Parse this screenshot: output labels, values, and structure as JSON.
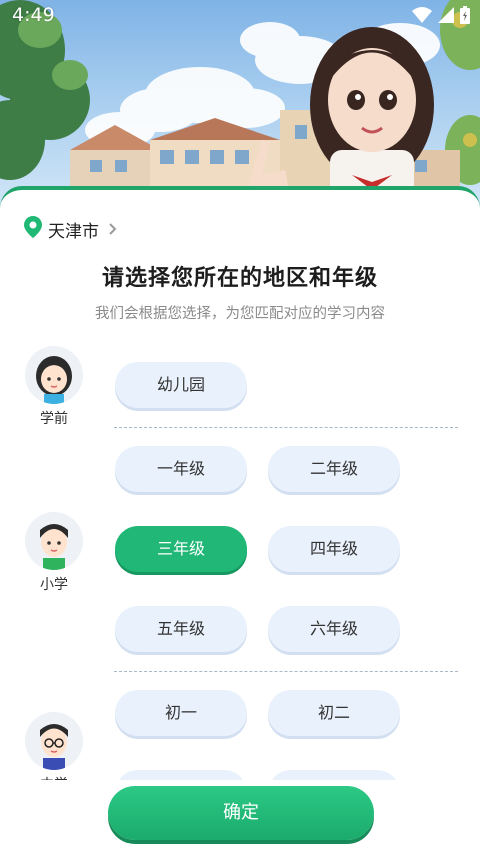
{
  "status_bar": {
    "time": "4:49"
  },
  "location": {
    "city": "天津市"
  },
  "title": "请选择您所在的地区和年级",
  "subtitle": "我们会根据您选择，为您匹配对应的学习内容",
  "stages": [
    {
      "label": "学前",
      "avatar": "girl-avatar",
      "grades": [
        "幼儿园"
      ]
    },
    {
      "label": "小学",
      "avatar": "boy-avatar",
      "grades": [
        "一年级",
        "二年级",
        "三年级",
        "四年级",
        "五年级",
        "六年级"
      ]
    },
    {
      "label": "中学",
      "avatar": "boy-glasses-avatar",
      "grades": [
        "初一",
        "初二"
      ]
    }
  ],
  "selected_grade": "三年级",
  "confirm_label": "确定",
  "colors": {
    "accent": "#21b877",
    "chip": "#e9f1fc",
    "header_border": "#1fa46a"
  },
  "icons": [
    "location-pin-icon",
    "chevron-right-icon",
    "wifi-icon",
    "signal-icon",
    "battery-icon"
  ]
}
